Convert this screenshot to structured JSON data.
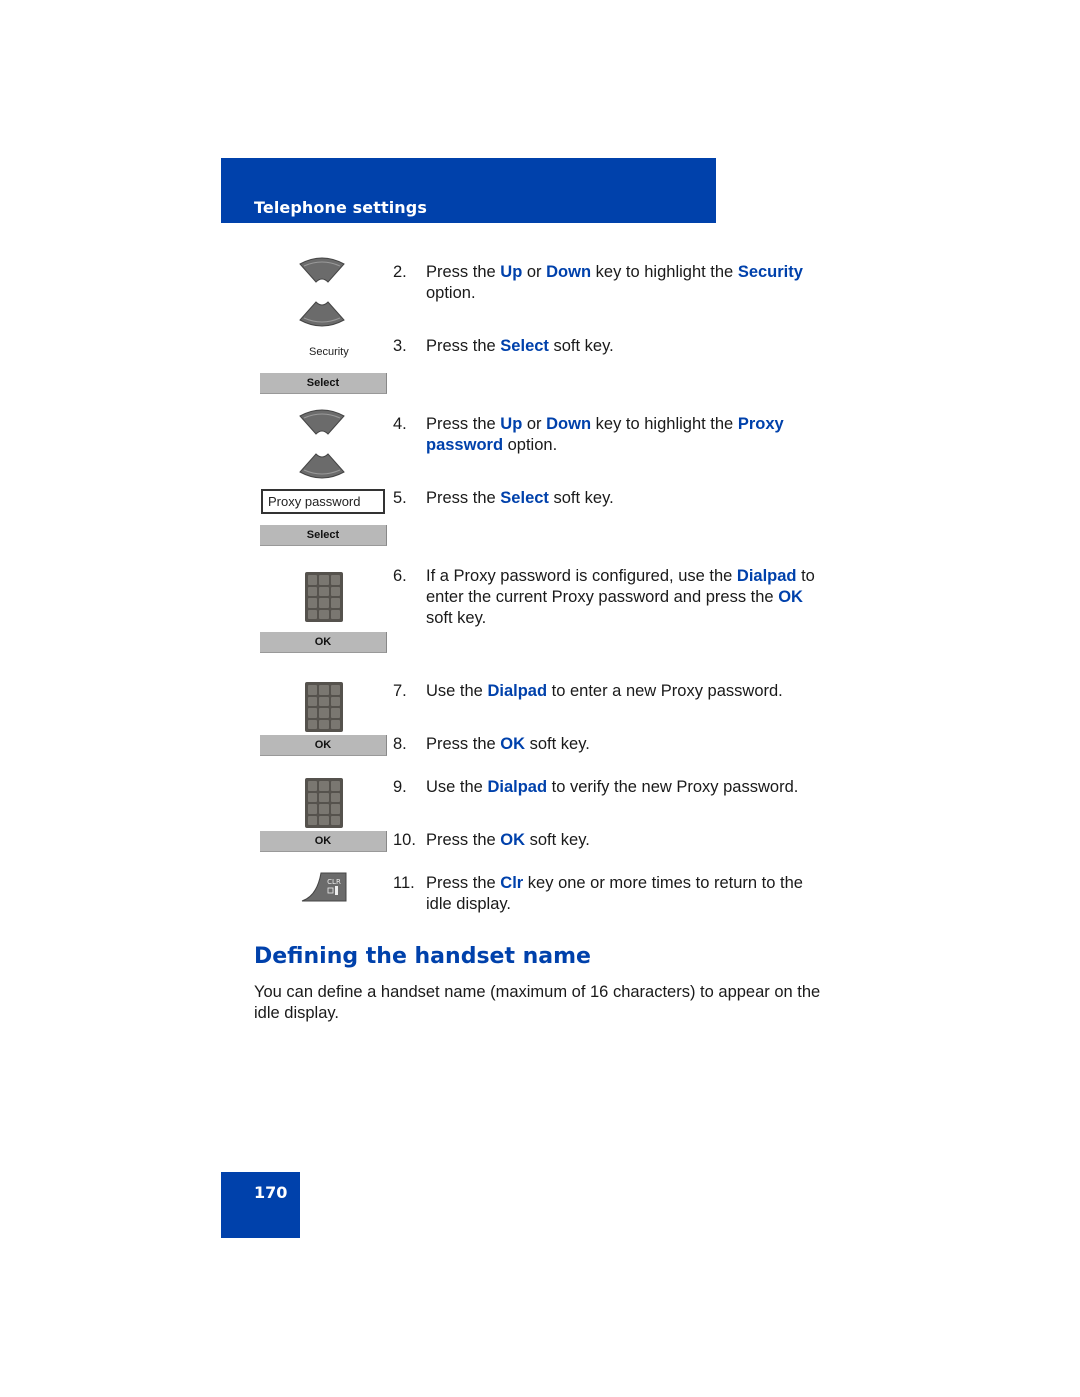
{
  "header": {
    "title": "Telephone settings",
    "color": "#0041ab"
  },
  "page_number": "170",
  "icons": {
    "screen_security": "Security",
    "screen_proxy_password": "Proxy password",
    "softkey_select": "Select",
    "softkey_ok": "OK",
    "clr_key_label": "CLR"
  },
  "steps": [
    {
      "num": "2.",
      "parts": [
        "Press the ",
        "Up",
        " or ",
        "Down",
        " key to highlight the ",
        "Security",
        " option."
      ]
    },
    {
      "num": "3.",
      "parts": [
        "Press the ",
        "Select",
        " soft key."
      ]
    },
    {
      "num": "4.",
      "parts": [
        "Press the ",
        "Up",
        " or ",
        "Down",
        " key to highlight the ",
        "Proxy password",
        " option."
      ]
    },
    {
      "num": "5.",
      "parts": [
        "Press the ",
        "Select",
        " soft key."
      ]
    },
    {
      "num": "6.",
      "parts": [
        "If a Proxy password is configured, use the ",
        "Dialpad",
        " to enter the current Proxy password and press the ",
        "OK",
        " soft key."
      ]
    },
    {
      "num": "7.",
      "parts": [
        "Use the ",
        "Dialpad",
        " to enter a new Proxy password."
      ]
    },
    {
      "num": "8.",
      "parts": [
        "Press the ",
        "OK",
        " soft key."
      ]
    },
    {
      "num": "9.",
      "parts": [
        "Use the ",
        "Dialpad",
        " to verify the new Proxy password."
      ]
    },
    {
      "num": "10.",
      "parts": [
        "Press the ",
        "OK",
        " soft key."
      ]
    },
    {
      "num": "11.",
      "parts": [
        "Press the ",
        "Clr",
        " key one or more times to return to the idle display."
      ]
    }
  ],
  "section": {
    "title": "Defining the handset name",
    "body": "You can define a handset name (maximum of 16 characters) to appear on the idle display."
  }
}
